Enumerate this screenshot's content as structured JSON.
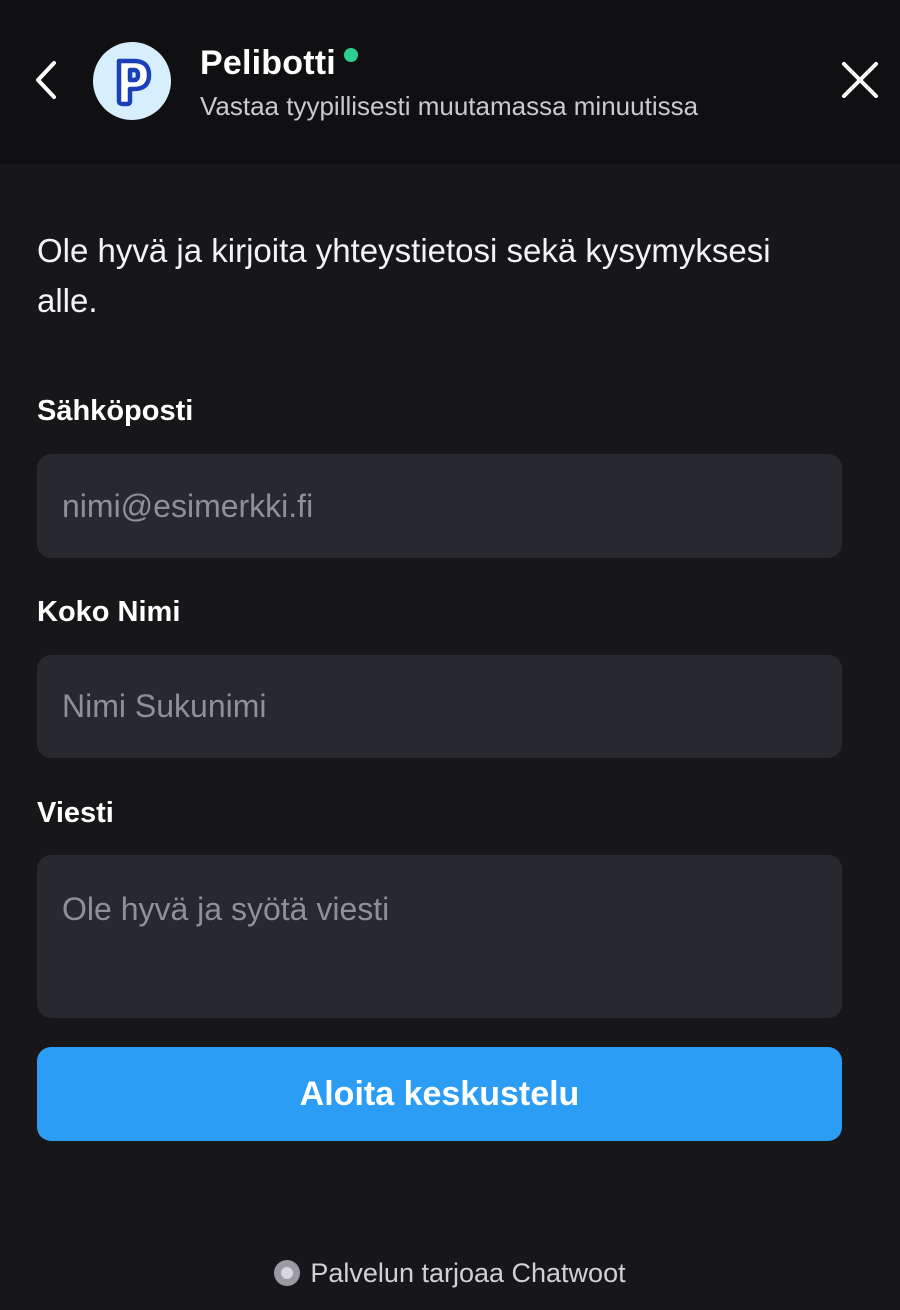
{
  "header": {
    "bot_name": "Pelibotti",
    "status": "Vastaa tyypillisesti muutamassa minuutissa",
    "avatar_letter": "P",
    "online_color": "#2fcf8f"
  },
  "form": {
    "intro": "Ole hyvä ja kirjoita yhteystietosi sekä kysymyksesi alle.",
    "email": {
      "label": "Sähköposti",
      "placeholder": "nimi@esimerkki.fi",
      "value": ""
    },
    "name": {
      "label": "Koko Nimi",
      "placeholder": "Nimi Sukunimi",
      "value": ""
    },
    "message": {
      "label": "Viesti",
      "placeholder": "Ole hyvä ja syötä viesti",
      "value": ""
    },
    "submit_label": "Aloita keskustelu",
    "accent_color": "#2b9df4"
  },
  "footer": {
    "branding": "Palvelun tarjoaa Chatwoot"
  },
  "icons": {
    "back": "chevron-left-icon",
    "close": "close-icon",
    "brand": "chatwoot-logo-icon"
  }
}
